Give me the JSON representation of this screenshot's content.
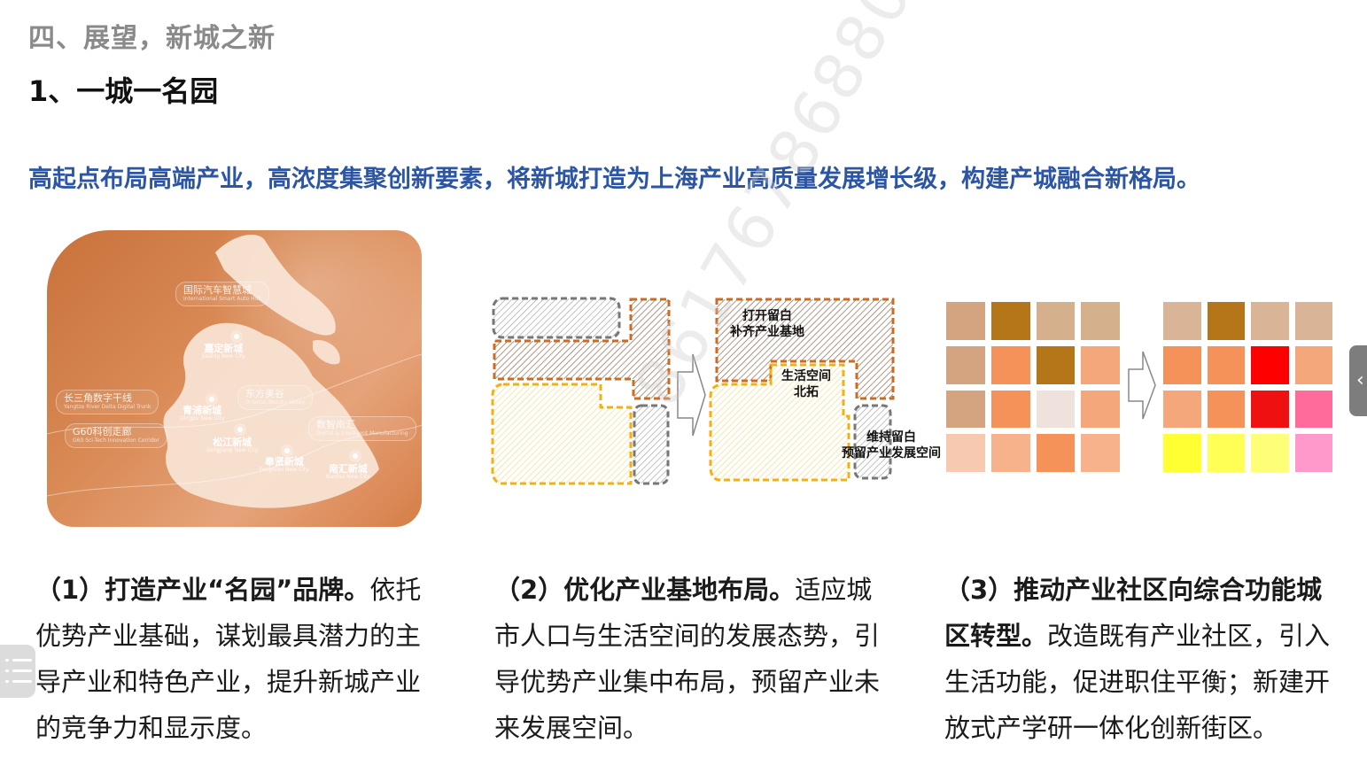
{
  "header": {
    "section_title": "四、展望，新城之新",
    "sub_title": "1、一城一名园"
  },
  "lead_text": "高起点布局高端产业，高浓度集聚创新要素，将新城打造为上海产业高质量发展增长级，构建产城融合新格局。",
  "map": {
    "tags": [
      {
        "cn": "国际汽车智慧城",
        "en": "International Smart Auto Hub"
      },
      {
        "cn": "长三角数字干线",
        "en": "Yangtze River Delta Digital Trunk"
      },
      {
        "cn": "G60科创走廊",
        "en": "G60 Sci-Tech Innovation Corridor"
      },
      {
        "cn": "东方美谷",
        "en": "Oriental Beauty Valley"
      },
      {
        "cn": "数智南汇",
        "en": "Digital & Intelligent Manufacturing"
      }
    ],
    "cities": [
      {
        "cn": "嘉定新城",
        "en": "Jiading New City"
      },
      {
        "cn": "青浦新城",
        "en": "Qingpu New City"
      },
      {
        "cn": "松江新城",
        "en": "Songjiang New City"
      },
      {
        "cn": "奉贤新城",
        "en": "Fengxian New City"
      },
      {
        "cn": "南汇新城",
        "en": "Nanhui New City"
      }
    ]
  },
  "diagram": {
    "label_open": "打开留白\n补齐产业基地",
    "label_life": "生活空间\n北拓",
    "label_keep": "维持留白\n预留产业发展空间"
  },
  "grid_before": [
    "#d4a37f",
    "#b5761a",
    "#d4b08c",
    "#d4b08c",
    "#d4a37f",
    "#f4925a",
    "#b5761a",
    "#f4a77a",
    "#d4a37f",
    "#f4925a",
    "#efe2dc",
    "#f4a77a",
    "#f7c9b0",
    "#f7b28c",
    "#f4925a",
    "#f7b28c"
  ],
  "grid_after": [
    "#d9b497",
    "#b5761a",
    "#d9b497",
    "#d9b497",
    "#f4925a",
    "#f4925a",
    "#ff0000",
    "#f4a77a",
    "#f4a77a",
    "#f4925a",
    "#ef1111",
    "#ff6b9a",
    "#ffff33",
    "#ffff55",
    "#ffff77",
    "#ff99cc"
  ],
  "captions": [
    {
      "bold": "（1）打造产业“名园”品牌。",
      "text": "依托优势产业基础，谋划最具潜力的主导产业和特色产业，提升新城产业的竞争力和显示度。"
    },
    {
      "bold": "（2）优化产业基地布局。",
      "text": "适应城市人口与生活空间的发展态势，引导优势产业集中布局，预留产业未来发展空间。"
    },
    {
      "bold": "（3）推动产业社区向综合功能城区转型。",
      "text": "改造既有产业社区，引入生活功能，促进职住平衡；新建开放式产学研一体化创新街区。"
    }
  ],
  "watermark": "86176786880"
}
